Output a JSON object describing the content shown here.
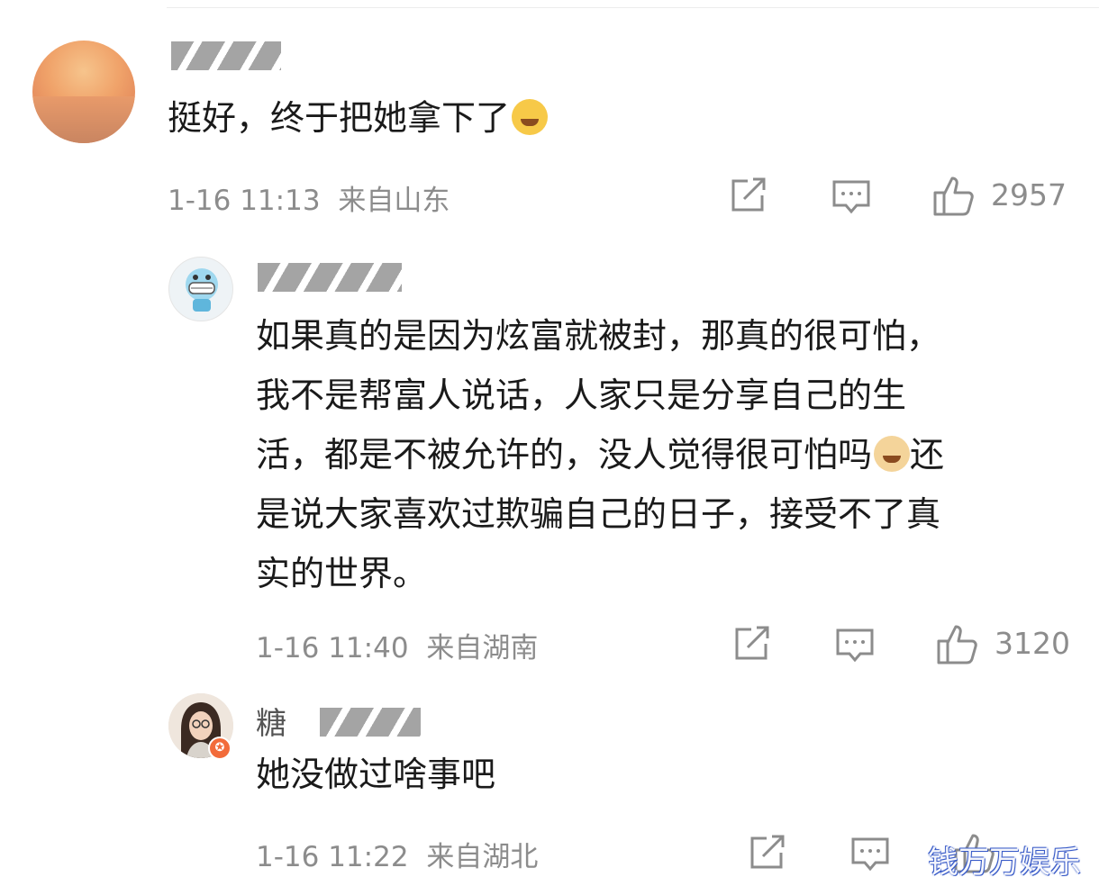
{
  "comments": [
    {
      "text": "挺好，终于把她拿下了",
      "emoji": "laughing-crying-emoji",
      "time": "1-16 11:13",
      "location": "来自山东",
      "likes": "2957"
    },
    {
      "text_lines": [
        "如果真的是因为炫富就被封，那真的很可怕，",
        "我不是帮富人说话，人家只是分享自己的生",
        "活，都是不被允许的，没人觉得很可怕吗",
        "是说大家喜欢过欺骗自己的日子，接受不了真",
        "实的世界。"
      ],
      "line3_suffix": "还",
      "emoji": "doge-emoji",
      "time": "1-16 11:40",
      "location": "来自湖南",
      "likes": "3120"
    },
    {
      "username_visible": "糖",
      "text": "她没做过啥事吧",
      "time": "1-16 11:22",
      "location": "来自湖北"
    }
  ],
  "watermark": "钱万万娱乐",
  "colors": {
    "meta_gray": "#8c8c8c",
    "text": "#1a1a1a",
    "verified_badge": "#f26b3a"
  }
}
